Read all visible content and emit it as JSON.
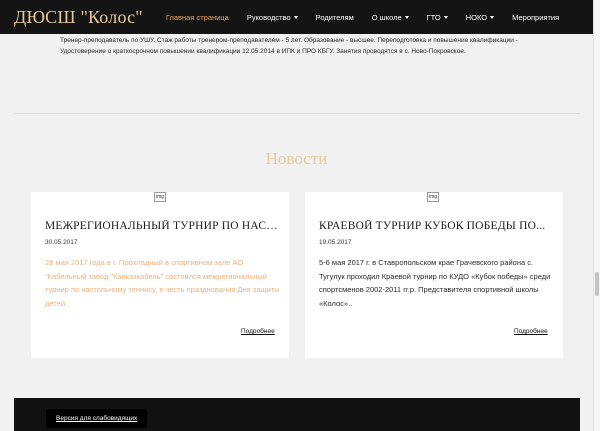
{
  "header": {
    "brand": "ДЮСШ \"Колос\"",
    "nav": [
      {
        "label": "Главная страница",
        "active": true,
        "dropdown": false
      },
      {
        "label": "Руководство",
        "active": false,
        "dropdown": true
      },
      {
        "label": "Родителям",
        "active": false,
        "dropdown": false
      },
      {
        "label": "О школе",
        "active": false,
        "dropdown": true
      },
      {
        "label": "ГТО",
        "active": false,
        "dropdown": true
      },
      {
        "label": "НОКО",
        "active": false,
        "dropdown": true
      },
      {
        "label": "Мероприятия",
        "active": false,
        "dropdown": false
      }
    ]
  },
  "coach_info": {
    "lines": [
      "Тренер-преподаватель по УШУ. Стаж работы тренером-преподавателем - 5 лет. Образование - высшее. Переподготовка и повышение квалификации -",
      "Удостоверение о краткосрочном повышении квалификации 12.05.2014 в ИПК и ПРО КБГУ. Занятия проводятся в с. Ново-Покровское."
    ]
  },
  "news": {
    "title": "Новости",
    "items": [
      {
        "image_alt": "img",
        "title": "МЕЖРЕГИОНАЛЬНЫЙ ТУРНИР ПО НАСТ...",
        "date": "30.05.2017",
        "excerpt": "28 мая 2017 года в г. Прохладный в спортивном зале АО \"Кабельный завод \"Кавказкабель\" состоялся межрегиональный турнир по настольному теннису, в честь празднования Дня защиты детей..",
        "more": "Подробнее"
      },
      {
        "image_alt": "img",
        "title": "КРАЕВОЙ ТУРНИР КУБОК ПОБЕДЫ ПО...",
        "date": "19.05.2017",
        "excerpt": "5-6 мая 2017 г. в Ставропольском крае Грачевского района с. Тугулук проходил Краевой турнир по КУДО «Кубок победы» среди спортсменов 2002-2011 гг.р. Представителя спортивной школы «Колос»..",
        "more": "Подробнее"
      }
    ]
  },
  "footer": {
    "vision_button": "Версия для слабовидящих"
  },
  "colors": {
    "navbar": "#141414",
    "brand": "#e8c99a",
    "active_nav": "#e8a35c",
    "accent_text": "#e8b07d",
    "background": "#f1f1f1"
  }
}
